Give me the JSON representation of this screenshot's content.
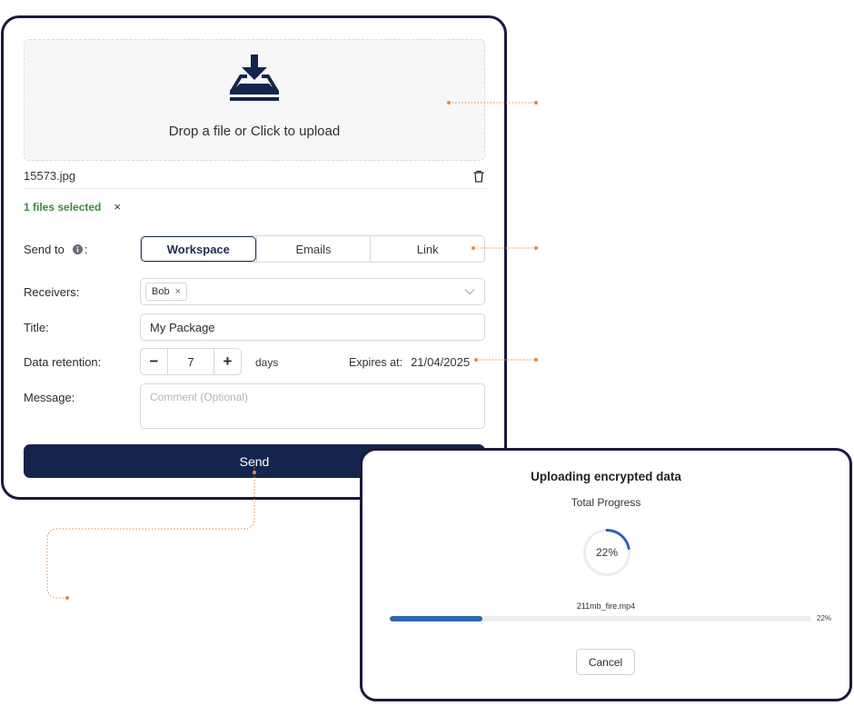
{
  "dropzone": {
    "text": "Drop a file or Click to upload",
    "icon": "upload-tray-icon"
  },
  "file": {
    "name": "15573.jpg",
    "delete_icon": "trash-icon"
  },
  "selection": {
    "text": "1 files selected",
    "clear": "×"
  },
  "send_to": {
    "label": "Send to",
    "suffix": ":",
    "info_icon": "info-icon",
    "options": [
      {
        "label": "Workspace",
        "active": true
      },
      {
        "label": "Emails",
        "active": false
      },
      {
        "label": "Link",
        "active": false
      }
    ]
  },
  "receivers": {
    "label": "Receivers:",
    "chips": [
      {
        "label": "Bob",
        "remove": "×"
      }
    ]
  },
  "title_field": {
    "label": "Title:",
    "value": "My Package"
  },
  "retention": {
    "label": "Data retention:",
    "minus": "−",
    "value": "7",
    "plus": "+",
    "unit": "days",
    "expires_label": "Expires at:",
    "expires_value": "21/04/2025"
  },
  "message": {
    "label": "Message:",
    "placeholder": "Comment (Optional)"
  },
  "send_button": {
    "label": "Send"
  },
  "upload_modal": {
    "title": "Uploading encrypted data",
    "subtitle": "Total Progress",
    "progress_percent": 22,
    "progress_text": "22%",
    "file_name": "211mb_fire.mp4",
    "file_progress_text": "22%",
    "cancel_label": "Cancel"
  },
  "colors": {
    "primary": "#13254d",
    "card_border": "#1b1840",
    "success": "#3b8a3b",
    "progress": "#2f64b5",
    "connector": "#e38a3c"
  }
}
